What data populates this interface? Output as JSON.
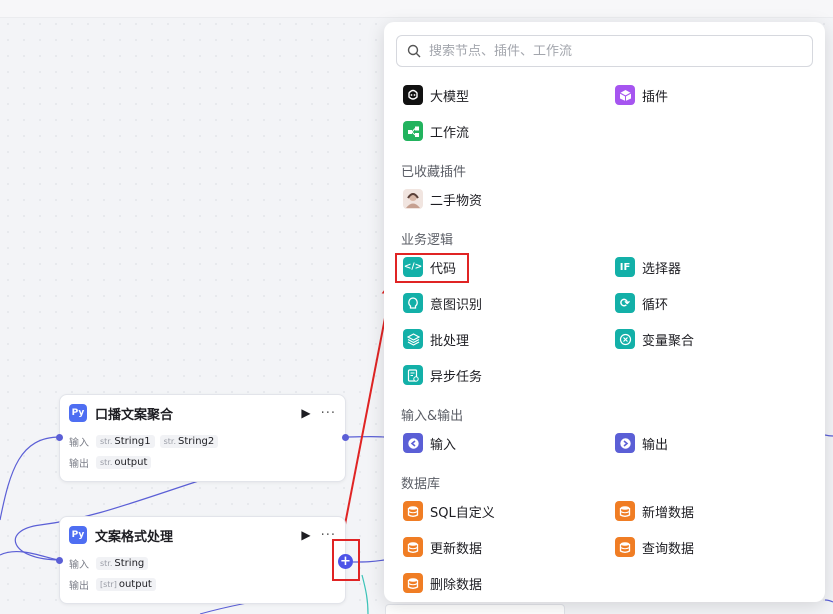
{
  "search": {
    "placeholder": "搜索节点、插件、工作流"
  },
  "top_items": [
    {
      "label": "大模型",
      "icon": "llm-icon",
      "color": "#111111"
    },
    {
      "label": "插件",
      "icon": "plugin-cube-icon",
      "color": "#a655f0"
    },
    {
      "label": "工作流",
      "icon": "workflow-icon",
      "color": "#22b35e"
    }
  ],
  "sections": {
    "favorites": {
      "title": "已收藏插件",
      "items": [
        {
          "label": "二手物资",
          "icon": "avatar-image-icon"
        }
      ]
    },
    "business_logic": {
      "title": "业务逻辑",
      "items": [
        {
          "label": "代码",
          "icon": "code-icon",
          "color": "#13b0a8"
        },
        {
          "label": "选择器",
          "icon": "if-selector-icon",
          "color": "#13b0a8"
        },
        {
          "label": "意图识别",
          "icon": "intent-icon",
          "color": "#13b0a8"
        },
        {
          "label": "循环",
          "icon": "loop-icon",
          "color": "#13b0a8"
        },
        {
          "label": "批处理",
          "icon": "batch-icon",
          "color": "#13b0a8"
        },
        {
          "label": "变量聚合",
          "icon": "variable-merge-icon",
          "color": "#13b0a8"
        },
        {
          "label": "异步任务",
          "icon": "async-task-icon",
          "color": "#13b0a8"
        }
      ]
    },
    "io": {
      "title": "输入&输出",
      "items": [
        {
          "label": "输入",
          "icon": "input-icon",
          "color": "#5b5fd6"
        },
        {
          "label": "输出",
          "icon": "output-icon",
          "color": "#5b5fd6"
        }
      ]
    },
    "database": {
      "title": "数据库",
      "items": [
        {
          "label": "SQL自定义",
          "icon": "sql-database-icon",
          "color": "#f07d24"
        },
        {
          "label": "新增数据",
          "icon": "add-data-icon",
          "color": "#f07d24"
        },
        {
          "label": "更新数据",
          "icon": "update-data-icon",
          "color": "#f07d24"
        },
        {
          "label": "查询数据",
          "icon": "query-data-icon",
          "color": "#f07d24"
        },
        {
          "label": "删除数据",
          "icon": "delete-data-icon",
          "color": "#f07d24"
        }
      ]
    }
  },
  "nodes": [
    {
      "title": "口播文案聚合",
      "input_label": "输入",
      "inputs": [
        {
          "type": "str.",
          "name": "String1"
        },
        {
          "type": "str.",
          "name": "String2"
        }
      ],
      "output_label": "输出",
      "outputs": [
        {
          "type": "str.",
          "name": "output"
        }
      ]
    },
    {
      "title": "文案格式处理",
      "input_label": "输入",
      "inputs": [
        {
          "type": "str.",
          "name": "String"
        }
      ],
      "output_label": "输出",
      "outputs": [
        {
          "type": "[str]",
          "name": "output"
        }
      ]
    }
  ],
  "colors": {
    "accent": "#4d53e8",
    "highlight": "#e02424",
    "edge": "#5b5fd6",
    "node_icon": "#4e6ef2"
  }
}
